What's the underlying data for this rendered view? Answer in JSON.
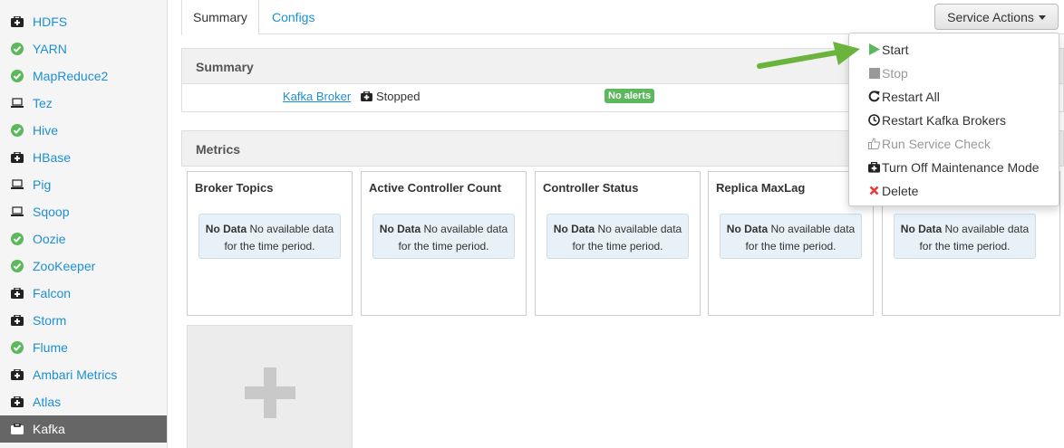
{
  "sidebar": {
    "items": [
      {
        "label": "HDFS",
        "icon": "maintenance-icon"
      },
      {
        "label": "YARN",
        "icon": "check-circle-icon"
      },
      {
        "label": "MapReduce2",
        "icon": "check-circle-icon"
      },
      {
        "label": "Tez",
        "icon": "laptop-icon"
      },
      {
        "label": "Hive",
        "icon": "check-circle-icon"
      },
      {
        "label": "HBase",
        "icon": "maintenance-icon"
      },
      {
        "label": "Pig",
        "icon": "laptop-icon"
      },
      {
        "label": "Sqoop",
        "icon": "laptop-icon"
      },
      {
        "label": "Oozie",
        "icon": "check-circle-icon"
      },
      {
        "label": "ZooKeeper",
        "icon": "check-circle-icon"
      },
      {
        "label": "Falcon",
        "icon": "maintenance-icon"
      },
      {
        "label": "Storm",
        "icon": "maintenance-icon"
      },
      {
        "label": "Flume",
        "icon": "check-circle-icon"
      },
      {
        "label": "Ambari Metrics",
        "icon": "maintenance-icon"
      },
      {
        "label": "Atlas",
        "icon": "maintenance-icon"
      },
      {
        "label": "Kafka",
        "icon": "maintenance-icon",
        "active": true
      }
    ]
  },
  "tabs": {
    "summary": "Summary",
    "configs": "Configs"
  },
  "service_actions": {
    "label": "Service Actions"
  },
  "summary": {
    "heading": "Summary",
    "component_link": "Kafka Broker",
    "status": "Stopped",
    "alerts_badge": "No alerts"
  },
  "metrics": {
    "heading": "Metrics",
    "widgets": [
      {
        "title": "Broker Topics",
        "nodata": "No Data",
        "message": "No available data for the time period."
      },
      {
        "title": "Active Controller Count",
        "nodata": "No Data",
        "message": "No available data for the time period."
      },
      {
        "title": "Controller Status",
        "nodata": "No Data",
        "message": "No available data for the time period."
      },
      {
        "title": "Replica MaxLag",
        "nodata": "No Data",
        "message": "No available data for the time period."
      },
      {
        "title": "",
        "nodata": "No Data",
        "message": "No available data for the time period."
      }
    ]
  },
  "menu": {
    "items": [
      {
        "label": "Start",
        "icon": "play-icon",
        "disabled": false
      },
      {
        "label": "Stop",
        "icon": "stop-icon",
        "disabled": true
      },
      {
        "label": "Restart All",
        "icon": "refresh-icon",
        "disabled": false
      },
      {
        "label": "Restart Kafka Brokers",
        "icon": "clock-icon",
        "disabled": false
      },
      {
        "label": "Run Service Check",
        "icon": "thumbs-up-icon",
        "disabled": true
      },
      {
        "label": "Turn Off Maintenance Mode",
        "icon": "maintenance-icon",
        "disabled": false
      },
      {
        "label": "Delete",
        "icon": "close-icon",
        "disabled": false
      }
    ]
  },
  "colors": {
    "link": "#1d8fd5",
    "ok": "#5cb85c",
    "active_bg": "#666666",
    "arrow": "#6ab43e",
    "delete": "#e43c3c"
  }
}
